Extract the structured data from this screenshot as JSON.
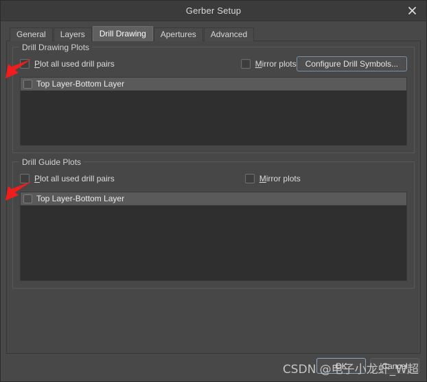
{
  "window": {
    "title": "Gerber Setup",
    "close_icon": "close-icon"
  },
  "tabs": [
    {
      "label": "General",
      "active": false
    },
    {
      "label": "Layers",
      "active": false
    },
    {
      "label": "Drill Drawing",
      "active": true
    },
    {
      "label": "Apertures",
      "active": false
    },
    {
      "label": "Advanced",
      "active": false
    }
  ],
  "groups": [
    {
      "title": "Drill Drawing Plots",
      "plot_all_label_mnemonic": "P",
      "plot_all_label_rest": "lot all used drill pairs",
      "plot_all_checked": false,
      "mirror_label_mnemonic": "M",
      "mirror_label_rest": "irror plots",
      "mirror_checked": false,
      "configure_button": "Configure Drill Symbols...",
      "list_items": [
        {
          "label": "Top Layer-Bottom Layer",
          "checked": false
        }
      ]
    },
    {
      "title": "Drill Guide Plots",
      "plot_all_label_mnemonic": "P",
      "plot_all_label_rest": "lot all used drill pairs",
      "plot_all_checked": false,
      "mirror_label_mnemonic": "M",
      "mirror_label_rest": "irror plots",
      "mirror_checked": false,
      "list_items": [
        {
          "label": "Top Layer-Bottom Layer",
          "checked": false
        }
      ]
    }
  ],
  "footer": {
    "ok_label": "OK",
    "cancel_label": "Cancel"
  },
  "watermark": {
    "text": "CSDN @电子小龙虾_W超"
  },
  "annotations": {
    "arrow_color": "#f01d1d",
    "arrow_count": 2
  },
  "colors": {
    "window_bg": "#484848",
    "titlebar_bg": "#3b3b3b",
    "panel_bg": "#474747",
    "listbox_bg": "#2f2f2f",
    "list_header_bg": "#5a5a5a",
    "active_tab_bg": "#606060",
    "accent_border": "#7b93ad",
    "text": "#d6d6d6"
  }
}
